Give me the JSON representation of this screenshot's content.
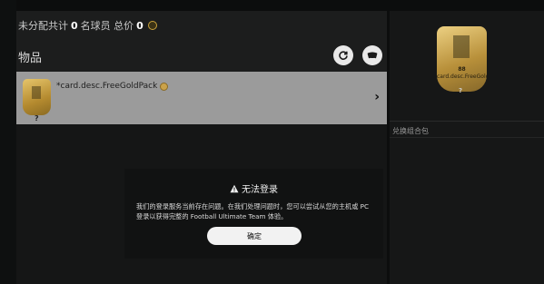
{
  "header": {
    "summary_prefix": "未分配共计",
    "player_count": "0",
    "summary_middle": "名球员 总价",
    "total_value": "0"
  },
  "items": {
    "title": "物品",
    "refresh_icon": "refresh-icon",
    "packs_icon": "cards-icon"
  },
  "item_row": {
    "pack_name": "*card.desc.FreeGoldPack",
    "quantity_mark": "?",
    "chevron": "›"
  },
  "right_panel": {
    "card_rating": "88",
    "card_name": "card.desc.FreeGoldP...",
    "card_quantity_mark": "?",
    "section_label": "兑换组合包"
  },
  "modal": {
    "title": "无法登录",
    "body": "我们的登录服务当前存在问题。在我们处理问题时，您可以尝试从您的主机或 PC 登录以获得完整的 Football Ultimate Team 体验。",
    "confirm_label": "确定"
  },
  "colors": {
    "background": "#0c0d0d",
    "gold": "#c9a23a",
    "row_highlight": "#9b9b9b",
    "modal_bg": "#111212"
  }
}
